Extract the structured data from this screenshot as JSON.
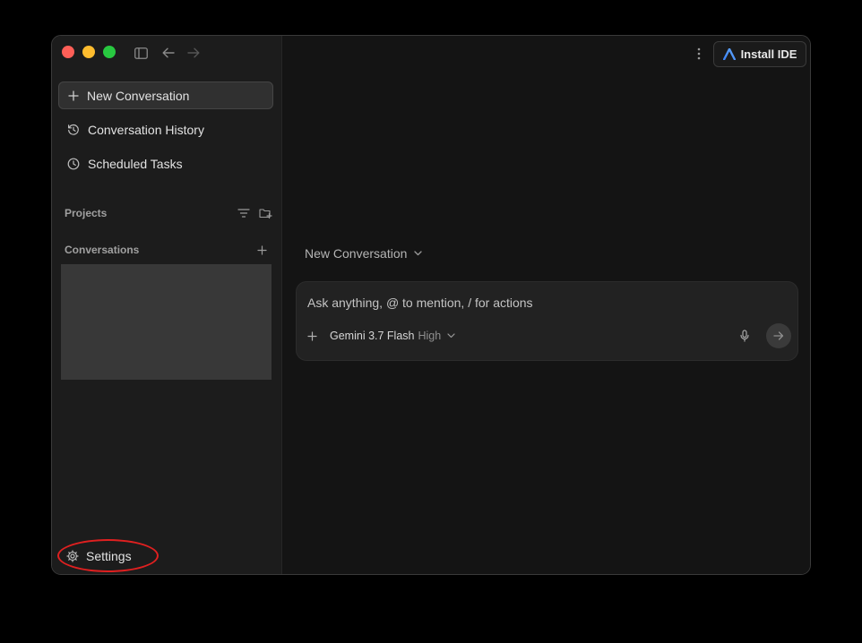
{
  "sidebar": {
    "new_conversation": "New Conversation",
    "conversation_history": "Conversation History",
    "scheduled_tasks": "Scheduled Tasks",
    "projects_label": "Projects",
    "conversations_label": "Conversations",
    "settings": "Settings"
  },
  "toolbar": {
    "install_ide": "Install IDE"
  },
  "main": {
    "conversation_title": "New Conversation",
    "prompt_placeholder": "Ask anything, @ to mention, / for actions",
    "model_name": "Gemini 3.7 Flash",
    "model_level": "High"
  },
  "colors": {
    "close": "#ff5f57",
    "minimize": "#febc2e",
    "zoom": "#28c840",
    "annotation": "#e02020"
  }
}
